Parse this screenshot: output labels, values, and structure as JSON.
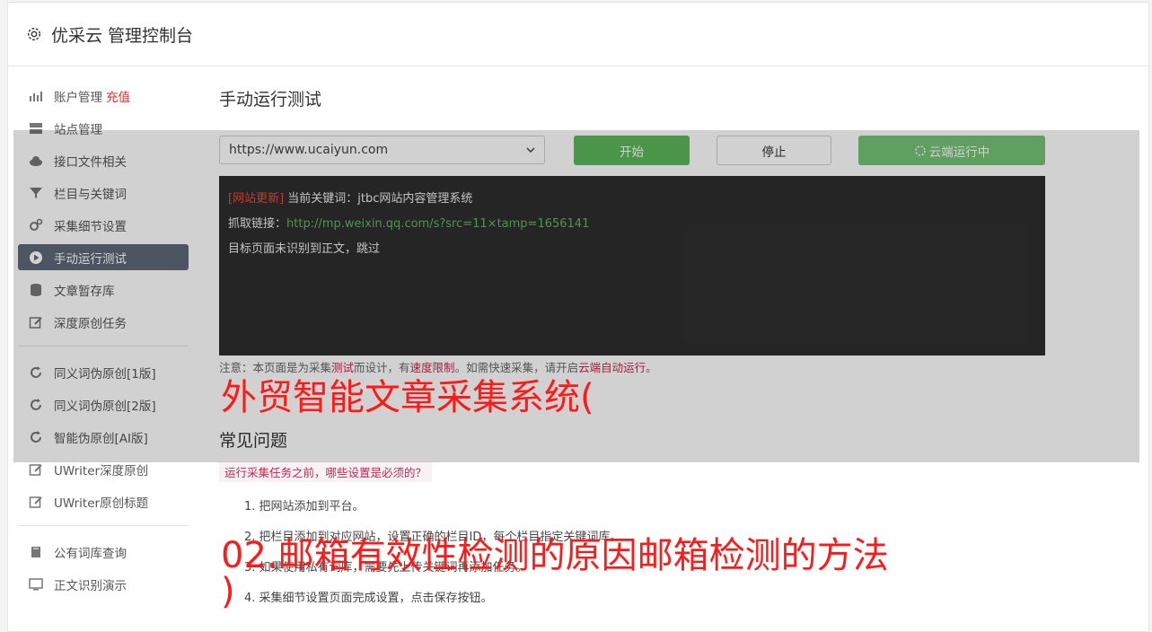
{
  "header": {
    "title": "优采云 管理控制台"
  },
  "sidebar": {
    "items": [
      {
        "label": "账户管理",
        "accent": "充值",
        "icon": "bar-chart-icon"
      },
      {
        "label": "站点管理",
        "icon": "server-icon"
      },
      {
        "label": "接口文件相关",
        "icon": "cloud-upload-icon"
      },
      {
        "label": "栏目与关键词",
        "icon": "filter-icon"
      },
      {
        "label": "采集细节设置",
        "icon": "gears-icon"
      },
      {
        "label": "手动运行测试",
        "icon": "play-circle-icon",
        "active": true
      },
      {
        "label": "文章暂存库",
        "icon": "database-icon"
      },
      {
        "label": "深度原创任务",
        "icon": "edit-icon"
      }
    ],
    "items2": [
      {
        "label": "同义词伪原创[1版]",
        "icon": "refresh-icon"
      },
      {
        "label": "同义词伪原创[2版]",
        "icon": "refresh-icon"
      },
      {
        "label": "智能伪原创[AI版]",
        "icon": "refresh-icon"
      },
      {
        "label": "UWriter深度原创",
        "icon": "edit-icon"
      },
      {
        "label": "UWriter原创标题",
        "icon": "edit-icon"
      }
    ],
    "items3": [
      {
        "label": "公有词库查询",
        "icon": "book-icon"
      },
      {
        "label": "正文识别演示",
        "icon": "monitor-icon"
      }
    ]
  },
  "main": {
    "title": "手动运行测试",
    "site_select": "https://www.ucaiyun.com",
    "start": "开始",
    "stop": "停止",
    "cloud": "云端运行中",
    "console": {
      "tag": "[网站更新]",
      "line1": " 当前关键词：jtbc网站内容管理系统",
      "line2_label": "抓取链接：",
      "line2_link": "http://mp.weixin.qq.com/s?src=11×tamp=1656141",
      "line3": "目标页面未识别到正文，跳过"
    },
    "note": {
      "p1": "注意：本页面是为采集",
      "kw1": "测试",
      "p2": "而设计，有",
      "kw2": "速度限制",
      "p3": "。如需快速采集，请开启",
      "kw3": "云端自动运行",
      "p4": "。"
    },
    "faq_title": "常见问题",
    "faq_question": "运行采集任务之前，哪些设置是必须的？",
    "faq_items": [
      "1. 把网站添加到平台。",
      "2. 把栏目添加到对应网站，设置正确的栏目ID，每个栏目指定关键词库。",
      "3. 如果使用私有词库，需要先上传关键词再添加任务。",
      "4. 采集细节设置页面完成设置，点击保存按钮。"
    ]
  },
  "overlay_text": {
    "line1": "外贸智能文章采集系统(",
    "line2": "02.邮箱有效性检测的原因邮箱检测的方法",
    "line3": ")"
  },
  "colors": {
    "accent": "#5cb85c",
    "overlay_red": "#ff1a1a",
    "active_nav": "#5d6a78"
  }
}
